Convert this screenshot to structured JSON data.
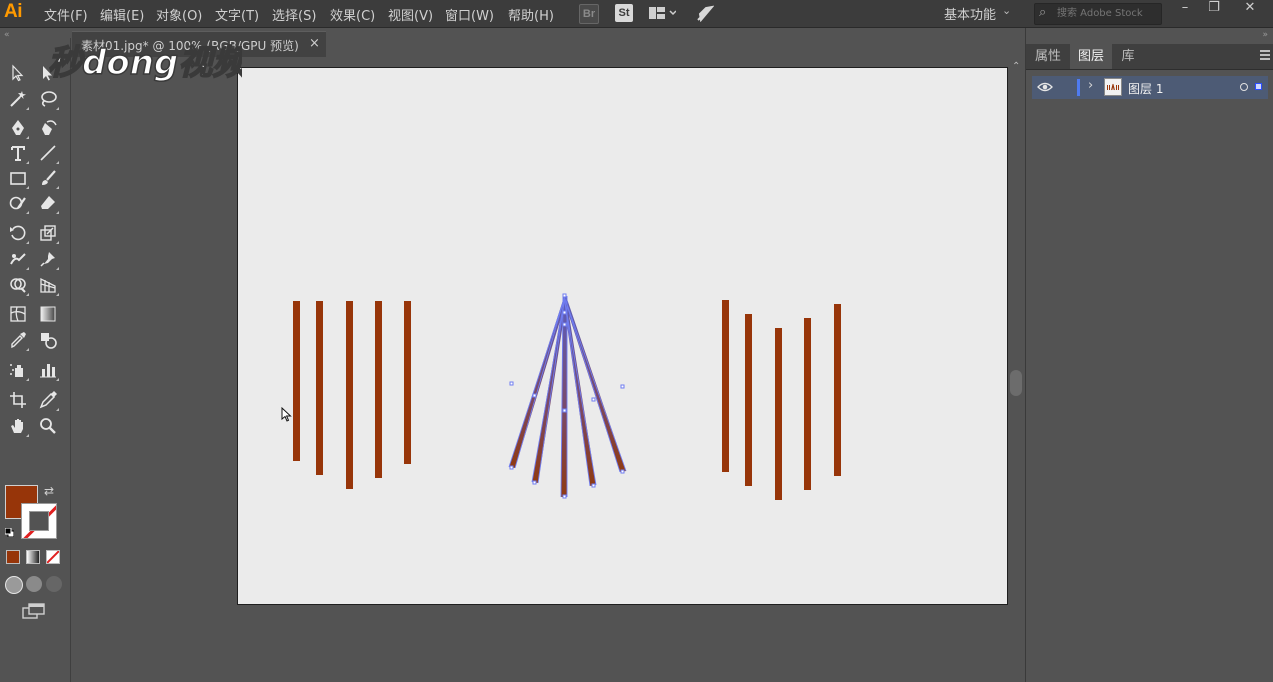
{
  "app": {
    "logo": "Ai"
  },
  "menu": [
    "文件(F)",
    "编辑(E)",
    "对象(O)",
    "文字(T)",
    "选择(S)",
    "效果(C)",
    "视图(V)",
    "窗口(W)",
    "帮助(H)"
  ],
  "top_icons": {
    "bridge": "Br",
    "stock": "St"
  },
  "workspace": {
    "label": "基本功能"
  },
  "search": {
    "placeholder": "搜索 Adobe Stock"
  },
  "window_controls": {
    "minimize": "–",
    "restore": "❐",
    "close": "✕"
  },
  "document_tab": {
    "title": "素材01.jpg* @ 100% (RGB/GPU 预览)",
    "close": "×"
  },
  "watermark": {
    "text": "秒dong视频"
  },
  "colors": {
    "fill": "#973509",
    "stroke_shape": "#8f3a12",
    "gradient_top": "#5b5fbf",
    "selection": "#6f7cf0",
    "artboard": "#ebebeb"
  },
  "tools": [
    "selection-tool",
    "direct-selection-tool",
    "magic-wand-tool",
    "lasso-tool",
    "pen-tool",
    "curvature-tool",
    "type-tool",
    "line-segment-tool",
    "rectangle-tool",
    "paintbrush-tool",
    "shaper-tool",
    "eraser-tool",
    "rotate-tool",
    "scale-tool",
    "warp-tool",
    "puppet-warp-tool",
    "shape-builder-tool",
    "perspective-grid-tool",
    "mesh-tool",
    "gradient-tool",
    "eyedropper-tool",
    "blend-tool",
    "symbol-sprayer-tool",
    "column-graph-tool",
    "artboard-tool",
    "slice-tool",
    "hand-tool",
    "zoom-tool"
  ],
  "panel": {
    "tabs": [
      "属性",
      "图层",
      "库"
    ],
    "active_tab": "图层",
    "layer": {
      "name": "图层 1",
      "color": "#4f7bf0"
    }
  }
}
